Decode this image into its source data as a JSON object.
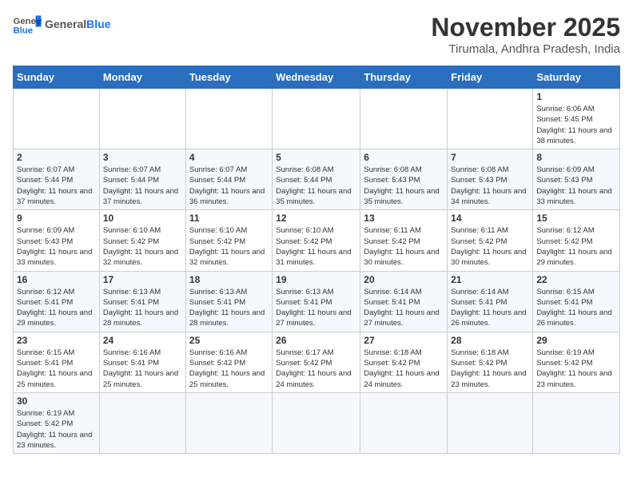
{
  "header": {
    "logo_general": "General",
    "logo_blue": "Blue",
    "month_title": "November 2025",
    "location": "Tirumala, Andhra Pradesh, India"
  },
  "weekdays": [
    "Sunday",
    "Monday",
    "Tuesday",
    "Wednesday",
    "Thursday",
    "Friday",
    "Saturday"
  ],
  "weeks": [
    [
      {
        "day": "",
        "info": ""
      },
      {
        "day": "",
        "info": ""
      },
      {
        "day": "",
        "info": ""
      },
      {
        "day": "",
        "info": ""
      },
      {
        "day": "",
        "info": ""
      },
      {
        "day": "",
        "info": ""
      },
      {
        "day": "1",
        "info": "Sunrise: 6:06 AM\nSunset: 5:45 PM\nDaylight: 11 hours and 38 minutes."
      }
    ],
    [
      {
        "day": "2",
        "info": "Sunrise: 6:07 AM\nSunset: 5:44 PM\nDaylight: 11 hours and 37 minutes."
      },
      {
        "day": "3",
        "info": "Sunrise: 6:07 AM\nSunset: 5:44 PM\nDaylight: 11 hours and 37 minutes."
      },
      {
        "day": "4",
        "info": "Sunrise: 6:07 AM\nSunset: 5:44 PM\nDaylight: 11 hours and 36 minutes."
      },
      {
        "day": "5",
        "info": "Sunrise: 6:08 AM\nSunset: 5:44 PM\nDaylight: 11 hours and 35 minutes."
      },
      {
        "day": "6",
        "info": "Sunrise: 6:08 AM\nSunset: 5:43 PM\nDaylight: 11 hours and 35 minutes."
      },
      {
        "day": "7",
        "info": "Sunrise: 6:08 AM\nSunset: 5:43 PM\nDaylight: 11 hours and 34 minutes."
      },
      {
        "day": "8",
        "info": "Sunrise: 6:09 AM\nSunset: 5:43 PM\nDaylight: 11 hours and 33 minutes."
      }
    ],
    [
      {
        "day": "9",
        "info": "Sunrise: 6:09 AM\nSunset: 5:43 PM\nDaylight: 11 hours and 33 minutes."
      },
      {
        "day": "10",
        "info": "Sunrise: 6:10 AM\nSunset: 5:42 PM\nDaylight: 11 hours and 32 minutes."
      },
      {
        "day": "11",
        "info": "Sunrise: 6:10 AM\nSunset: 5:42 PM\nDaylight: 11 hours and 32 minutes."
      },
      {
        "day": "12",
        "info": "Sunrise: 6:10 AM\nSunset: 5:42 PM\nDaylight: 11 hours and 31 minutes."
      },
      {
        "day": "13",
        "info": "Sunrise: 6:11 AM\nSunset: 5:42 PM\nDaylight: 11 hours and 30 minutes."
      },
      {
        "day": "14",
        "info": "Sunrise: 6:11 AM\nSunset: 5:42 PM\nDaylight: 11 hours and 30 minutes."
      },
      {
        "day": "15",
        "info": "Sunrise: 6:12 AM\nSunset: 5:42 PM\nDaylight: 11 hours and 29 minutes."
      }
    ],
    [
      {
        "day": "16",
        "info": "Sunrise: 6:12 AM\nSunset: 5:41 PM\nDaylight: 11 hours and 29 minutes."
      },
      {
        "day": "17",
        "info": "Sunrise: 6:13 AM\nSunset: 5:41 PM\nDaylight: 11 hours and 28 minutes."
      },
      {
        "day": "18",
        "info": "Sunrise: 6:13 AM\nSunset: 5:41 PM\nDaylight: 11 hours and 28 minutes."
      },
      {
        "day": "19",
        "info": "Sunrise: 6:13 AM\nSunset: 5:41 PM\nDaylight: 11 hours and 27 minutes."
      },
      {
        "day": "20",
        "info": "Sunrise: 6:14 AM\nSunset: 5:41 PM\nDaylight: 11 hours and 27 minutes."
      },
      {
        "day": "21",
        "info": "Sunrise: 6:14 AM\nSunset: 5:41 PM\nDaylight: 11 hours and 26 minutes."
      },
      {
        "day": "22",
        "info": "Sunrise: 6:15 AM\nSunset: 5:41 PM\nDaylight: 11 hours and 26 minutes."
      }
    ],
    [
      {
        "day": "23",
        "info": "Sunrise: 6:15 AM\nSunset: 5:41 PM\nDaylight: 11 hours and 25 minutes."
      },
      {
        "day": "24",
        "info": "Sunrise: 6:16 AM\nSunset: 5:41 PM\nDaylight: 11 hours and 25 minutes."
      },
      {
        "day": "25",
        "info": "Sunrise: 6:16 AM\nSunset: 5:42 PM\nDaylight: 11 hours and 25 minutes."
      },
      {
        "day": "26",
        "info": "Sunrise: 6:17 AM\nSunset: 5:42 PM\nDaylight: 11 hours and 24 minutes."
      },
      {
        "day": "27",
        "info": "Sunrise: 6:18 AM\nSunset: 5:42 PM\nDaylight: 11 hours and 24 minutes."
      },
      {
        "day": "28",
        "info": "Sunrise: 6:18 AM\nSunset: 5:42 PM\nDaylight: 11 hours and 23 minutes."
      },
      {
        "day": "29",
        "info": "Sunrise: 6:19 AM\nSunset: 5:42 PM\nDaylight: 11 hours and 23 minutes."
      }
    ],
    [
      {
        "day": "30",
        "info": "Sunrise: 6:19 AM\nSunset: 5:42 PM\nDaylight: 11 hours and 23 minutes."
      },
      {
        "day": "",
        "info": ""
      },
      {
        "day": "",
        "info": ""
      },
      {
        "day": "",
        "info": ""
      },
      {
        "day": "",
        "info": ""
      },
      {
        "day": "",
        "info": ""
      },
      {
        "day": "",
        "info": ""
      }
    ]
  ]
}
